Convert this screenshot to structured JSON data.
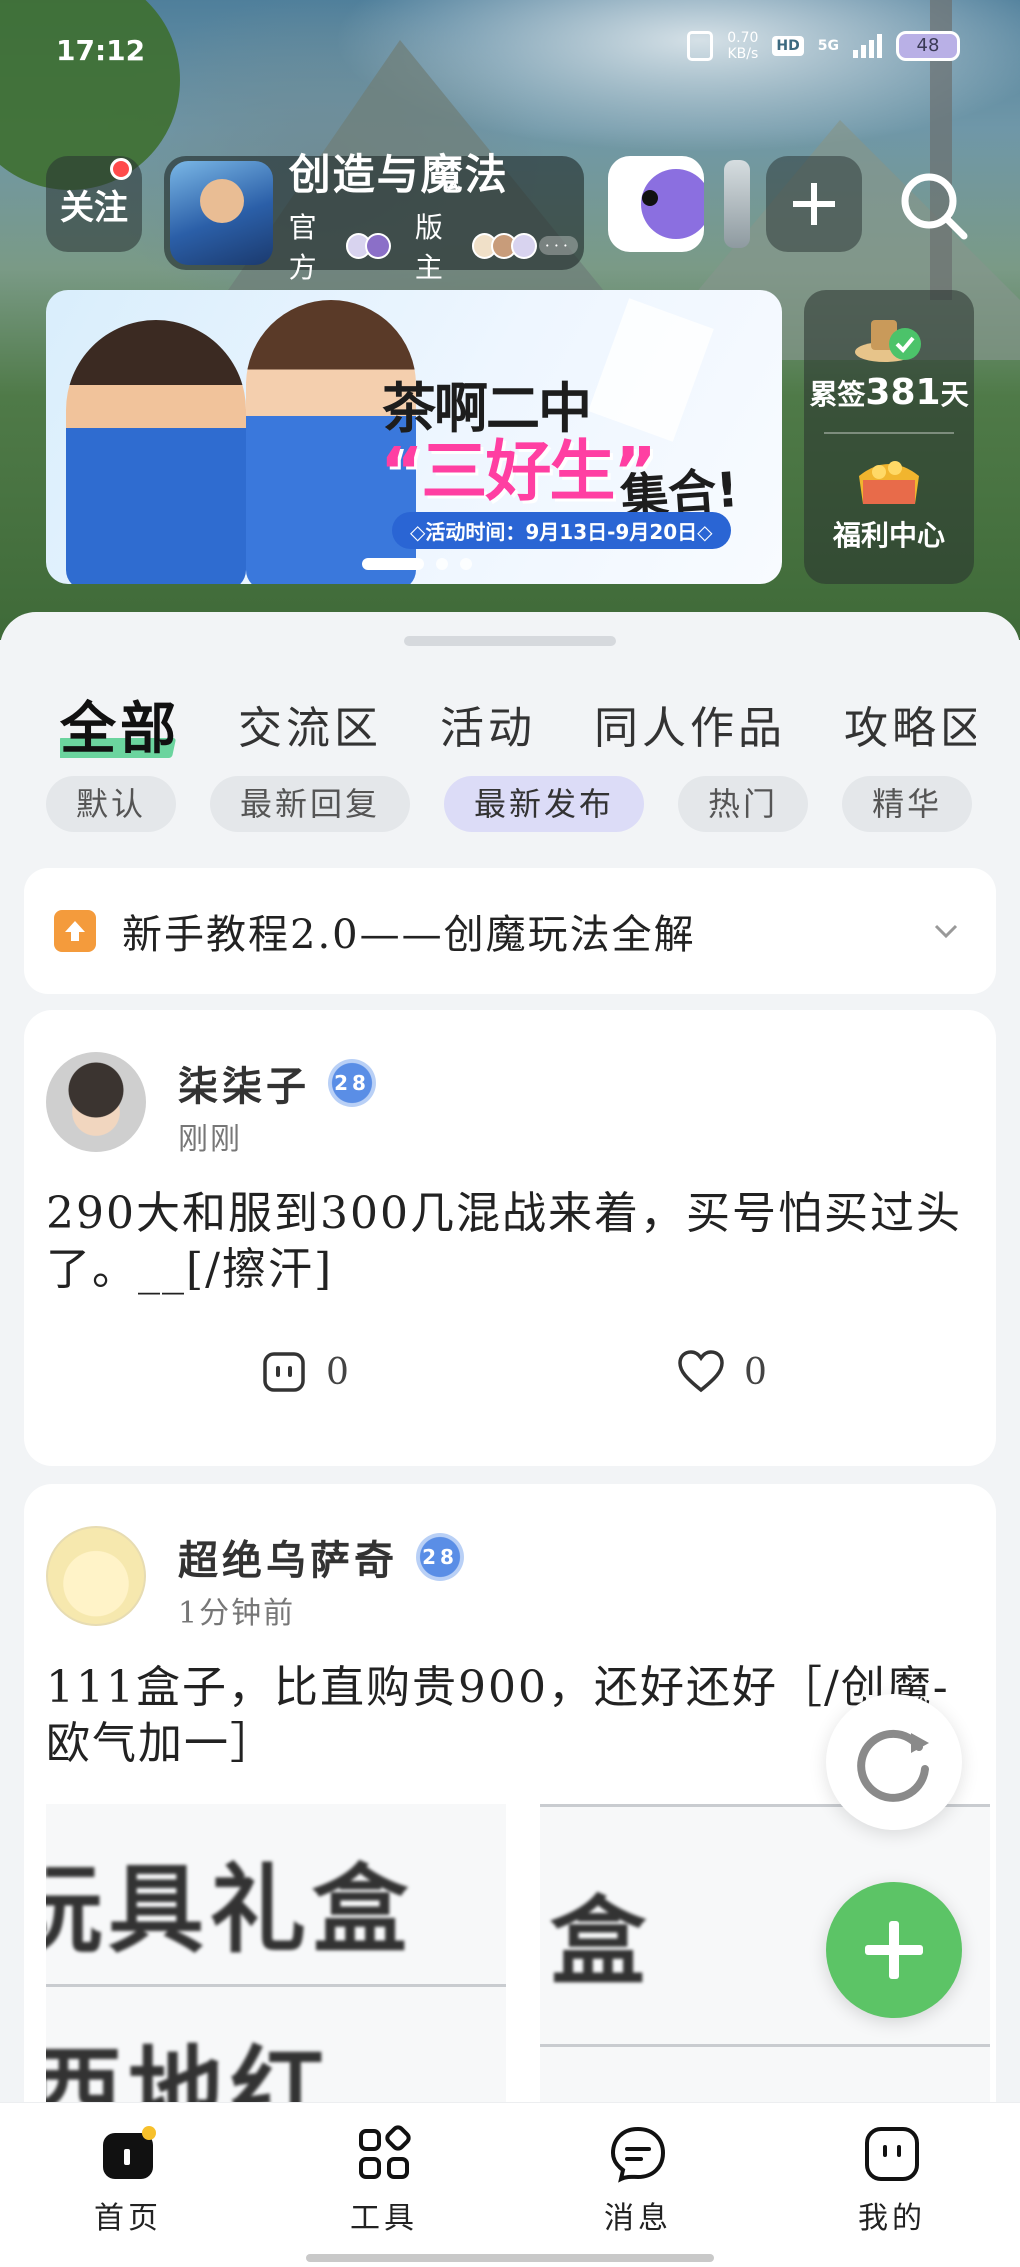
{
  "status_bar": {
    "time": "17:12",
    "net_speed_value": "0.70",
    "net_speed_unit": "KB/s",
    "hd": "HD",
    "network": "5G",
    "battery": "48"
  },
  "top_bar": {
    "follow_label": "关注",
    "game_title": "创造与魔法",
    "official_label": "官方",
    "moderator_label": "版主",
    "more_avatars": "···"
  },
  "banner": {
    "title_line1": "茶啊二中",
    "title_line2": "“三好生”",
    "title_line3": "集合!",
    "date_text": "◇活动时间：9月13日-9月20日◇",
    "slides": 3,
    "active_slide": 1
  },
  "side_panel": {
    "checkin_prefix": "累签",
    "checkin_days": "381",
    "checkin_suffix": "天",
    "welfare_label": "福利中心"
  },
  "tabs": [
    "全部",
    "交流区",
    "活动",
    "同人作品",
    "攻略区"
  ],
  "active_tab": 0,
  "filters": [
    "默认",
    "最新回复",
    "最新发布",
    "热门",
    "精华"
  ],
  "active_filter": 2,
  "notice": {
    "title": "新手教程2.0——创魔玩法全解"
  },
  "posts": [
    {
      "author": "柒柒子",
      "level": "28",
      "time": "刚刚",
      "content": "290大和服到300几混战来着，买号怕买过头了。__[/擦汗]",
      "comments": "0",
      "likes": "0"
    },
    {
      "author": "超绝乌萨奇",
      "level": "28",
      "time": "1分钟前",
      "content": "111盒子，比直购贵900，还好还好［/创魔-欧气加一］",
      "image_left_text1": "玩具礼盒",
      "image_left_text2": "西地红",
      "image_right_text": "盒"
    }
  ],
  "bottom_nav": {
    "home": "首页",
    "tools": "工具",
    "messages": "消息",
    "me": "我的"
  },
  "colors": {
    "accent_green": "#5cc466",
    "tab_highlight": "#6bd49e",
    "active_chip": "#dcdcf7",
    "notice_icon": "#f49b3c",
    "banner_pink": "#ff3fa2"
  }
}
